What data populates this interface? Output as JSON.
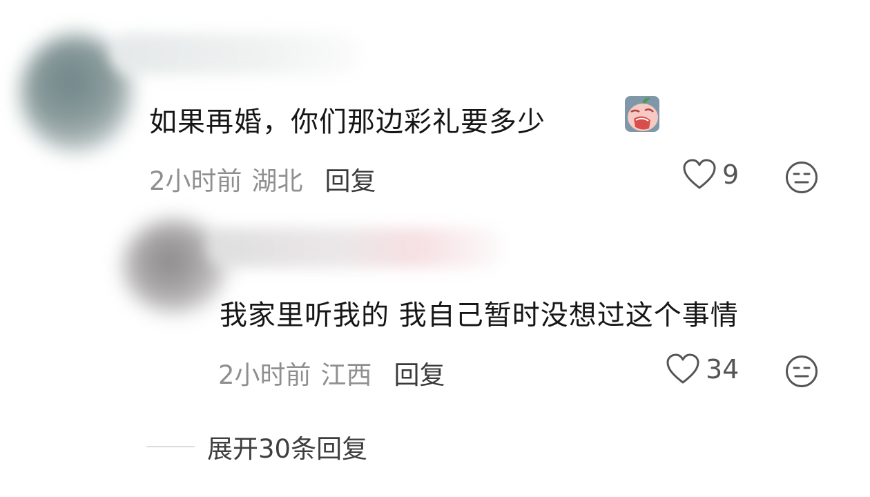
{
  "comments": [
    {
      "text": "如果再婚，你们那边彩礼要多少",
      "inline_emoji": "crying-face-emoji",
      "time": "2小时前",
      "location": "湖北",
      "reply_label": "回复",
      "like_icon": "heart-outline-icon",
      "likes": "9",
      "reaction_icon": "neutral-face-icon"
    },
    {
      "text": "我家里听我的 我自己暂时没想过这个事情",
      "time": "2小时前",
      "location": "江西",
      "reply_label": "回复",
      "like_icon": "heart-outline-icon",
      "likes": "34",
      "reaction_icon": "neutral-face-icon"
    }
  ],
  "expand_replies": {
    "label": "展开30条回复"
  },
  "colors": {
    "text_primary": "#161616",
    "text_meta": "#8f8f8f",
    "text_action": "#3a3a3a",
    "icon_stroke": "#555555"
  }
}
